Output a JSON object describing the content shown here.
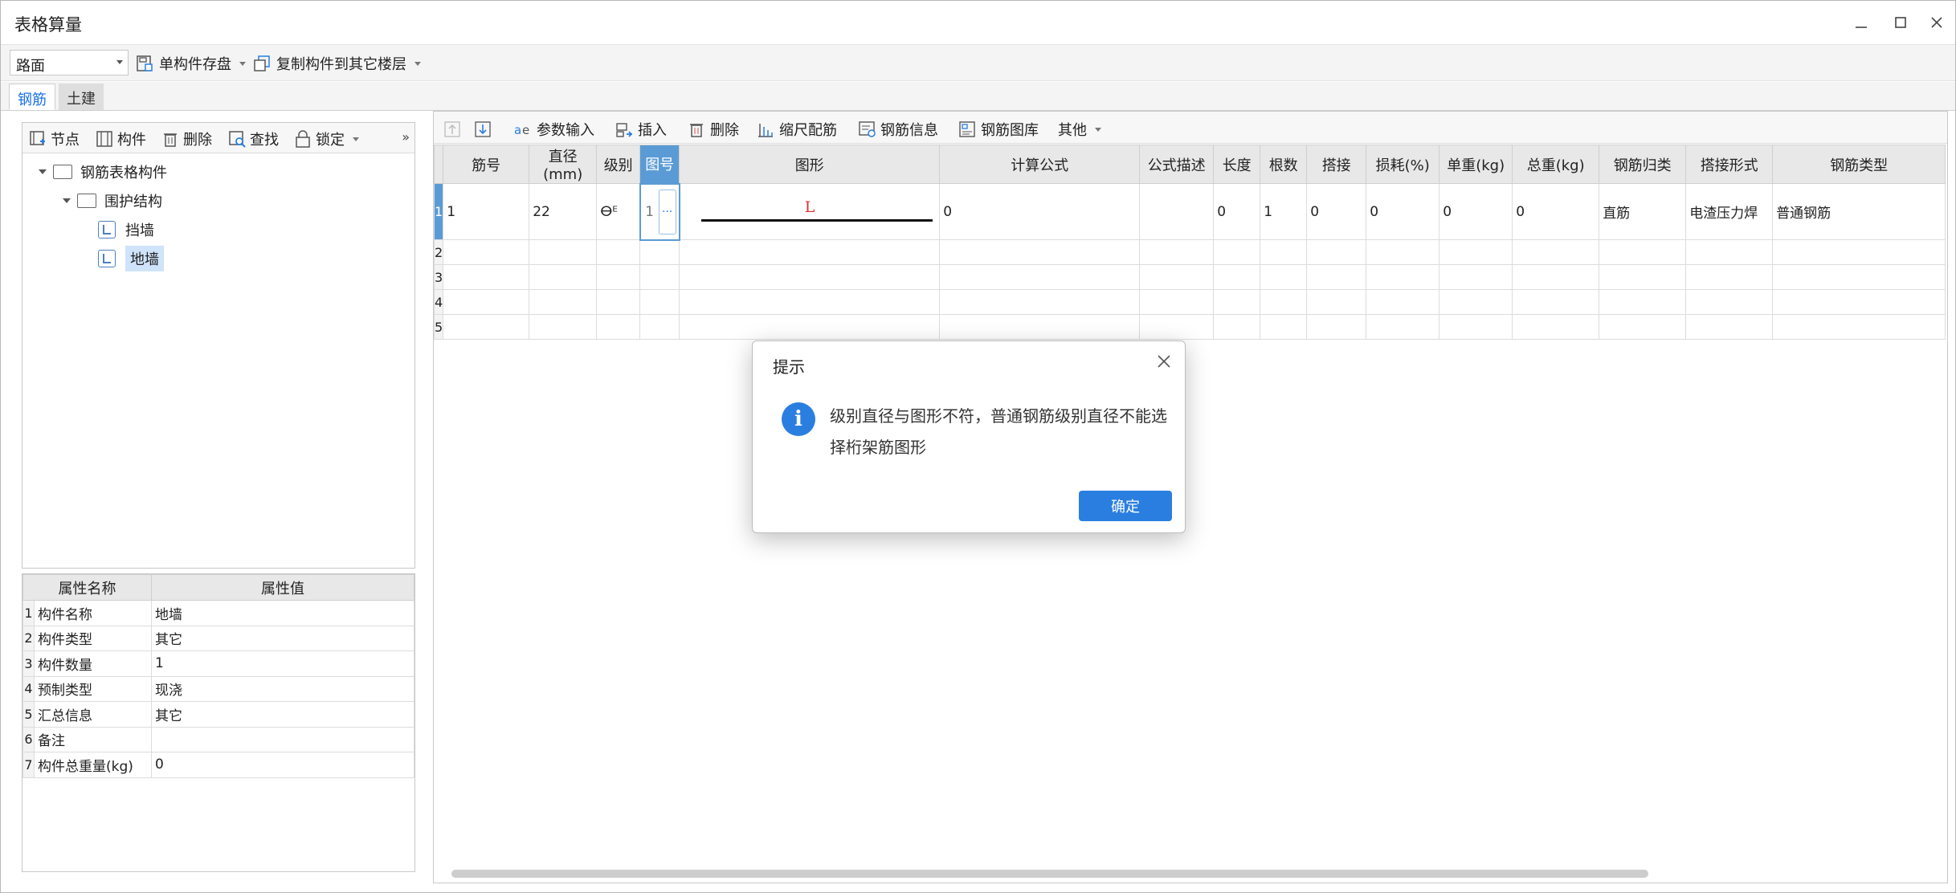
{
  "window": {
    "title": "表格算量"
  },
  "toolbar": {
    "floor_combo": "路面",
    "save_label": "单构件存盘",
    "copy_label": "复制构件到其它楼层"
  },
  "tabs": [
    {
      "label": "钢筋",
      "active": true
    },
    {
      "label": "土建",
      "active": false
    }
  ],
  "left_toolbar": {
    "node": "节点",
    "component": "构件",
    "delete": "删除",
    "find": "查找",
    "lock": "锁定"
  },
  "tree": {
    "root": "钢筋表格构件",
    "group": "围护结构",
    "items": [
      {
        "label": "挡墙",
        "selected": false
      },
      {
        "label": "地墙",
        "selected": true
      }
    ]
  },
  "properties": {
    "headers": [
      "属性名称",
      "属性值"
    ],
    "rows": [
      {
        "n": "1",
        "name": "构件名称",
        "value": "地墙"
      },
      {
        "n": "2",
        "name": "构件类型",
        "value": "其它"
      },
      {
        "n": "3",
        "name": "构件数量",
        "value": "1"
      },
      {
        "n": "4",
        "name": "预制类型",
        "value": "现浇"
      },
      {
        "n": "5",
        "name": "汇总信息",
        "value": "其它"
      },
      {
        "n": "6",
        "name": "备注",
        "value": ""
      },
      {
        "n": "7",
        "name": "构件总重量(kg)",
        "value": "0"
      }
    ]
  },
  "grid_toolbar": {
    "param_input": "参数输入",
    "insert": "插入",
    "delete": "删除",
    "scale_rebar": "缩尺配筋",
    "rebar_info": "钢筋信息",
    "rebar_library": "钢筋图库",
    "other": "其他"
  },
  "grid": {
    "headers": [
      "筋号",
      "直径(mm)",
      "级别",
      "图号",
      "图形",
      "计算公式",
      "公式描述",
      "长度",
      "根数",
      "搭接",
      "损耗(%)",
      "单重(kg)",
      "总重(kg)",
      "钢筋归类",
      "搭接形式",
      "钢筋类型"
    ],
    "row1": {
      "n": "1",
      "jin_hao": "1",
      "diameter": "22",
      "grade": "ⴱᴱ",
      "figure_no": "1",
      "figure_btn": "···",
      "shape_label": "L",
      "formula": "0",
      "formula_desc": "",
      "length": "0",
      "count": "1",
      "lap": "0",
      "loss": "0",
      "unit_weight": "0",
      "total_weight": "0",
      "category": "直筋",
      "lap_type": "电渣压力焊",
      "rebar_type": "普通钢筋"
    },
    "empty_rows": [
      "2",
      "3",
      "4",
      "5"
    ]
  },
  "dialog": {
    "title": "提示",
    "message": "级别直径与图形不符，普通钢筋级别直径不能选择桁架筋图形",
    "ok_label": "确定"
  }
}
